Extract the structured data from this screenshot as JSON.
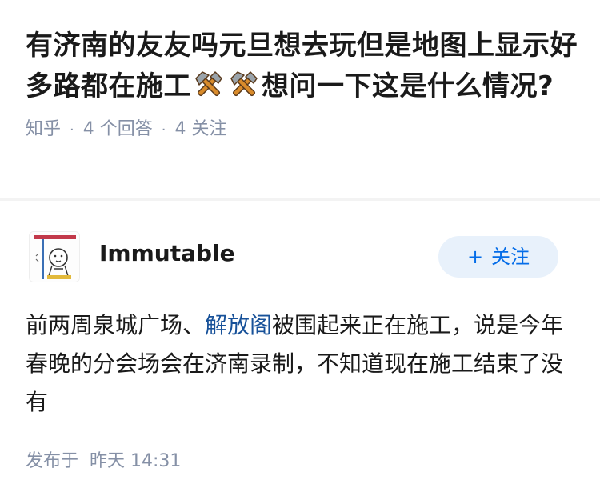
{
  "question": {
    "title_part1": "有济南的友友吗元旦想去玩但是地图上显示好多路都在施工",
    "title_part2": "想问一下这是什么情况?",
    "emoji_icons": [
      "hammer-and-pick-icon",
      "hammer-and-pick-icon"
    ],
    "source": "知乎",
    "answers_count": "4 个回答",
    "followers_count": "4 关注"
  },
  "answer": {
    "author_name": "Immutable",
    "follow_label": "关注",
    "follow_icon": "plus-icon",
    "body_part1": "前两周泉城广场、",
    "body_link": "解放阁",
    "body_part2": "被围起来正在施工，说是今年春晚的分会场会在济南录制，不知道现在施工结束了没有",
    "published_label": "发布于",
    "published_time": "昨天 14:31"
  },
  "colors": {
    "title_text": "#1a1a1a",
    "meta_text": "#8590a6",
    "link": "#175199",
    "follow_button_bg": "#e8f1fb",
    "follow_button_text": "#056de8"
  }
}
